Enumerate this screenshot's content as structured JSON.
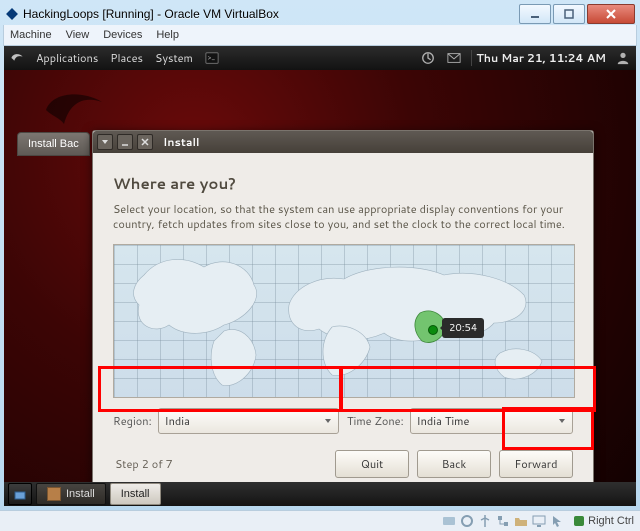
{
  "window": {
    "title": "HackingLoops [Running] - Oracle VM VirtualBox",
    "menus": [
      "Machine",
      "View",
      "Devices",
      "Help"
    ]
  },
  "gnome_panel": {
    "apps_label": "Applications",
    "places_label": "Places",
    "system_label": "System",
    "clock": "Thu Mar 21, 11:24 AM"
  },
  "desktop": {
    "bg_button": "Install Bac"
  },
  "install": {
    "title": "Install",
    "heading": "Where are you?",
    "description": "Select your location, so that the system can use appropriate display conventions for your country, fetch updates from sites close to you, and set the clock to the correct local time.",
    "marker_time": "20:54",
    "region_label": "Region:",
    "region_value": "India",
    "tz_label": "Time Zone:",
    "tz_value": "India Time",
    "step": "Step 2 of 7",
    "quit": "Quit",
    "back": "Back",
    "forward": "Forward"
  },
  "taskbar": {
    "item1": "Install",
    "item2": "Install"
  },
  "vb_status": {
    "hostkey": "Right Ctrl"
  }
}
